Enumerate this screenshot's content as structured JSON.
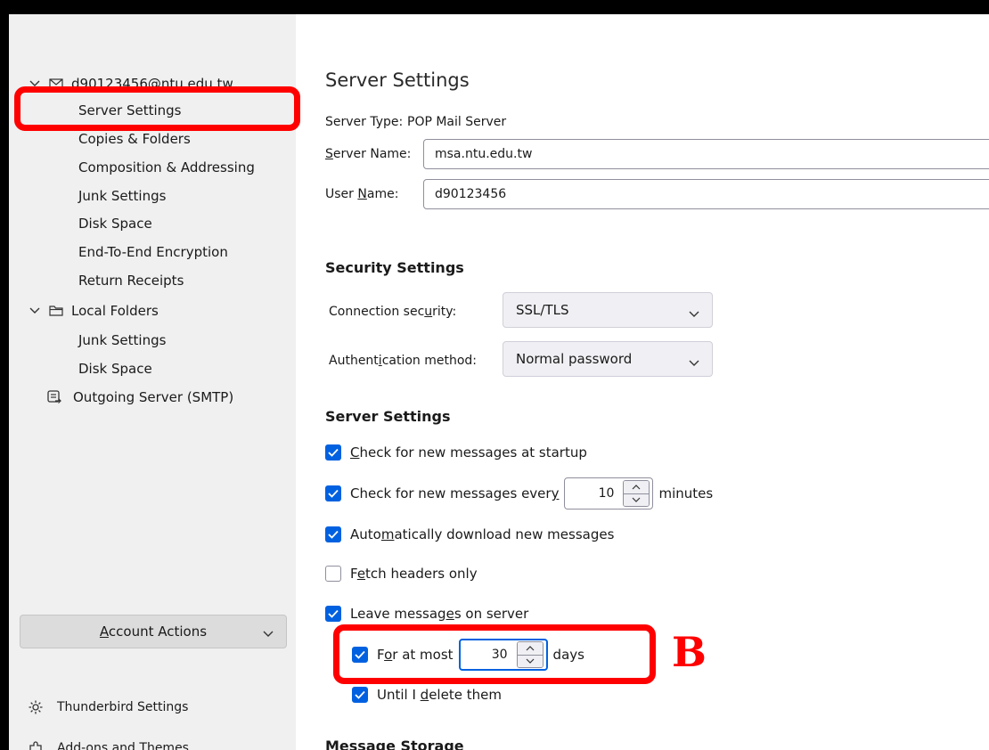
{
  "sidebar": {
    "account": {
      "name": "d90123456@ntu.edu.tw",
      "icon": "mail-account-icon",
      "expanded": true
    },
    "account_items": [
      {
        "label": "Server Settings",
        "selected": true
      },
      {
        "label": "Copies & Folders"
      },
      {
        "label": "Composition & Addressing"
      },
      {
        "label": "Junk Settings"
      },
      {
        "label": "Disk Space"
      },
      {
        "label": "End-To-End Encryption"
      },
      {
        "label": "Return Receipts"
      }
    ],
    "local_folders": {
      "label": "Local Folders",
      "icon": "folder-icon",
      "expanded": true
    },
    "local_items": [
      {
        "label": "Junk Settings"
      },
      {
        "label": "Disk Space"
      }
    ],
    "outgoing": {
      "label": "Outgoing Server (SMTP)",
      "icon": "outgoing-server-icon"
    },
    "account_actions": {
      "label": "Account Actions",
      "mnemonic": "A"
    },
    "thunderbird_settings": {
      "label": "Thunderbird Settings",
      "icon": "gear-icon"
    },
    "addons": {
      "label": "Add-ons and Themes",
      "icon": "puzzle-icon"
    }
  },
  "main": {
    "title": "Server Settings",
    "server_type": {
      "label": "Server Type:",
      "value": "POP Mail Server"
    },
    "server_name": {
      "label_mn": "S",
      "label_rest": "erver Name:",
      "value": "msa.ntu.edu.tw"
    },
    "user_name": {
      "label_pre": "User ",
      "label_mn": "N",
      "label_post": "ame:",
      "value": "d90123456"
    },
    "security": {
      "heading": "Security Settings",
      "connection": {
        "label_pre": "Connection sec",
        "label_mn": "u",
        "label_post": "rity:",
        "value": "SSL/TLS"
      },
      "auth": {
        "label_pre": "Authent",
        "label_mn": "i",
        "label_post": "cation method:",
        "value": "Normal password"
      }
    },
    "server_settings": {
      "heading": "Server Settings",
      "check_startup": {
        "mn": "C",
        "rest": "heck for new messages at startup",
        "checked": true
      },
      "check_every": {
        "pre": "Check for new messages ever",
        "mn": "y",
        "interval": "10",
        "suffix": "minutes",
        "checked": true
      },
      "auto_download": {
        "pre": "Auto",
        "mn": "m",
        "post": "atically download new messages",
        "checked": true
      },
      "fetch_headers": {
        "pre": "F",
        "mn": "e",
        "post": "tch headers only",
        "checked": false
      },
      "leave_on_server": {
        "pre": "Leave messag",
        "mn": "e",
        "post": "s on server",
        "checked": true
      },
      "for_at_most": {
        "pre": "F",
        "mn": "o",
        "post": "r at most",
        "days": "30",
        "suffix": "days",
        "checked": true
      },
      "until_delete": {
        "pre": "Until I ",
        "mn": "d",
        "post": "elete them",
        "checked": true
      }
    },
    "next_heading_partial": "Message Storage"
  },
  "annotation": {
    "letter": "B",
    "color": "#ff0000"
  },
  "colors": {
    "accent": "#0061e0",
    "sidebar_bg": "#f0f0f0",
    "highlight": "#ff0000"
  }
}
